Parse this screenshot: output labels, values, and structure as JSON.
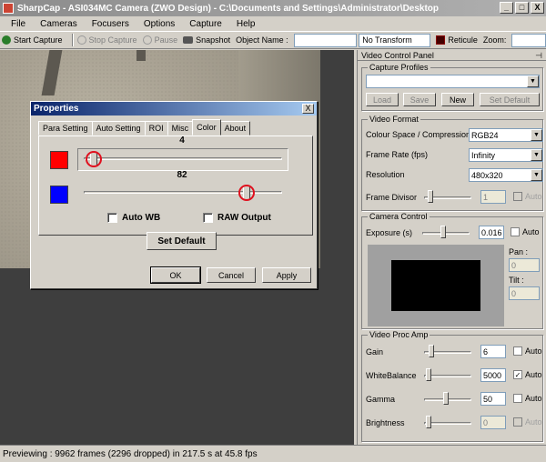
{
  "window": {
    "title": "SharpCap - ASI034MC Camera (ZWO Design) - C:\\Documents and Settings\\Administrator\\Desktop",
    "minimize": "_",
    "maximize": "□",
    "close": "X"
  },
  "menu": [
    "File",
    "Cameras",
    "Focusers",
    "Options",
    "Capture",
    "Help"
  ],
  "toolbar": {
    "start_capture": "Start Capture",
    "stop_capture": "Stop Capture",
    "pause": "Pause",
    "snapshot": "Snapshot",
    "object_name_label": "Object Name :",
    "object_name_value": "",
    "transform_value": "No Transform",
    "reticule": "Reticule",
    "zoom_label": "Zoom:"
  },
  "dialog": {
    "title": "Properties",
    "close": "X",
    "tabs": [
      "Para Setting",
      "Auto Setting",
      "ROI",
      "Misc",
      "Color",
      "About"
    ],
    "active_tab": "Color",
    "red_value": "4",
    "blue_value": "82",
    "red_level_fraction": 0.05,
    "blue_level_fraction": 0.82,
    "auto_wb_label": "Auto WB",
    "raw_output_label": "RAW Output",
    "set_default": "Set Default",
    "ok": "OK",
    "cancel": "Cancel",
    "apply": "Apply",
    "colors": {
      "red": "#ff0000",
      "blue": "#0000ff",
      "highlight": "#e0101e"
    }
  },
  "panel": {
    "title": "Video Control Panel",
    "pin": "⊣",
    "capture_profiles": {
      "label": "Capture Profiles",
      "value": "",
      "load": "Load",
      "save": "Save",
      "new": "New",
      "set_default": "Set Default"
    },
    "video_format": {
      "label": "Video Format",
      "rows": [
        {
          "label": "Colour Space / Compression",
          "value": "RGB24"
        },
        {
          "label": "Frame Rate (fps)",
          "value": "Infinity"
        },
        {
          "label": "Resolution",
          "value": "480x320"
        }
      ],
      "frame_divisor_label": "Frame Divisor",
      "frame_divisor_value": "1",
      "auto": "Auto"
    },
    "camera_control": {
      "label": "Camera Control",
      "exposure_label": "Exposure (s)",
      "exposure_value": "0.016",
      "auto": "Auto",
      "pan_label": "Pan :",
      "pan_value": "0",
      "tilt_label": "Tilt :",
      "tilt_value": "0"
    },
    "video_proc_amp": {
      "label": "Video Proc Amp",
      "rows": [
        {
          "label": "Gain",
          "value": "6",
          "auto": "Auto",
          "checked": false,
          "enabled": true,
          "level": 0.1
        },
        {
          "label": "WhiteBalance",
          "value": "5000",
          "auto": "Auto",
          "checked": true,
          "enabled": true,
          "level": 0.05
        },
        {
          "label": "Gamma",
          "value": "50",
          "auto": "Auto",
          "checked": false,
          "enabled": true,
          "level": 0.45
        },
        {
          "label": "Brightness",
          "value": "0",
          "auto": "Auto",
          "checked": false,
          "enabled": false,
          "level": 0.05
        }
      ]
    }
  },
  "status": "Previewing : 9962 frames (2296 dropped) in 217.5 s at 45.8 fps"
}
